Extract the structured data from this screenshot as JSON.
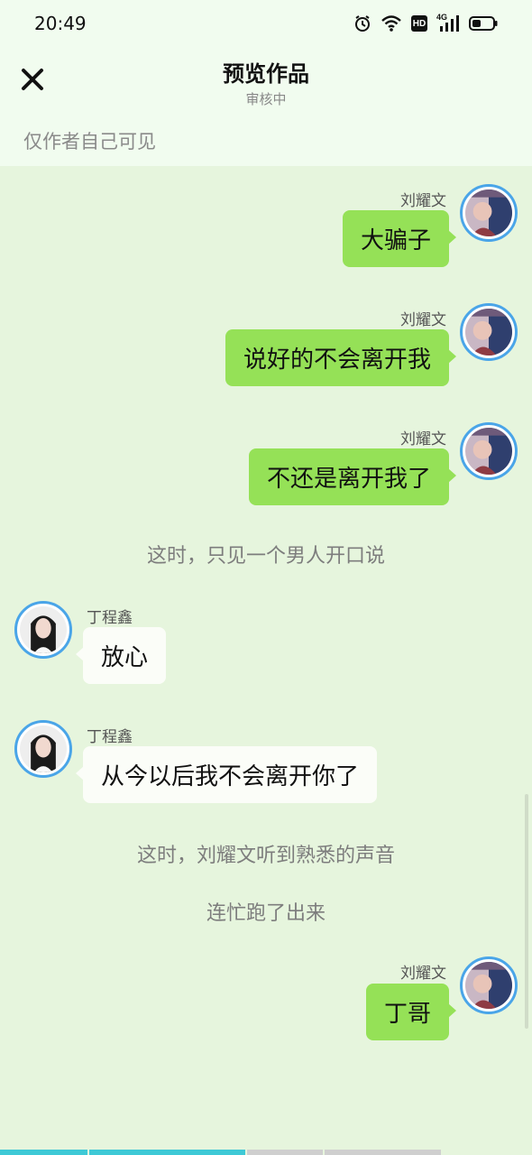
{
  "status_bar": {
    "time": "20:49",
    "icons": [
      "alarm-icon",
      "wifi-icon",
      "hd-icon",
      "signal-4g-icon",
      "battery-icon"
    ],
    "hd_label": "HD",
    "network_label": "4G"
  },
  "header": {
    "title": "预览作品",
    "subtitle": "审核中",
    "close_icon": "close-icon",
    "visibility_note": "仅作者自己可见"
  },
  "messages": [
    {
      "type": "bubble",
      "side": "right",
      "name": "刘耀文",
      "text": "大骗子"
    },
    {
      "type": "bubble",
      "side": "right",
      "name": "刘耀文",
      "text": "说好的不会离开我"
    },
    {
      "type": "bubble",
      "side": "right",
      "name": "刘耀文",
      "text": "不还是离开我了"
    },
    {
      "type": "narration",
      "text": "这时，只见一个男人开口说"
    },
    {
      "type": "bubble",
      "side": "left",
      "name": "丁程鑫",
      "text": "放心"
    },
    {
      "type": "bubble",
      "side": "left",
      "name": "丁程鑫",
      "text": "从今以后我不会离开你了"
    },
    {
      "type": "narration",
      "text": "这时，刘耀文听到熟悉的声音"
    },
    {
      "type": "narration",
      "text": "连忙跑了出来"
    },
    {
      "type": "bubble",
      "side": "right",
      "name": "刘耀文",
      "text": "丁哥"
    }
  ],
  "colors": {
    "background": "#e6f5dd",
    "header_background": "#f1fcef",
    "right_bubble": "#95e157",
    "left_bubble": "#fbfdf8",
    "avatar_border": "#4aa5e8",
    "progress_active": "#3ec9d6",
    "progress_inactive": "#cfcfcf"
  },
  "progress": {
    "segments": 5,
    "completed_fraction": 0.47
  }
}
